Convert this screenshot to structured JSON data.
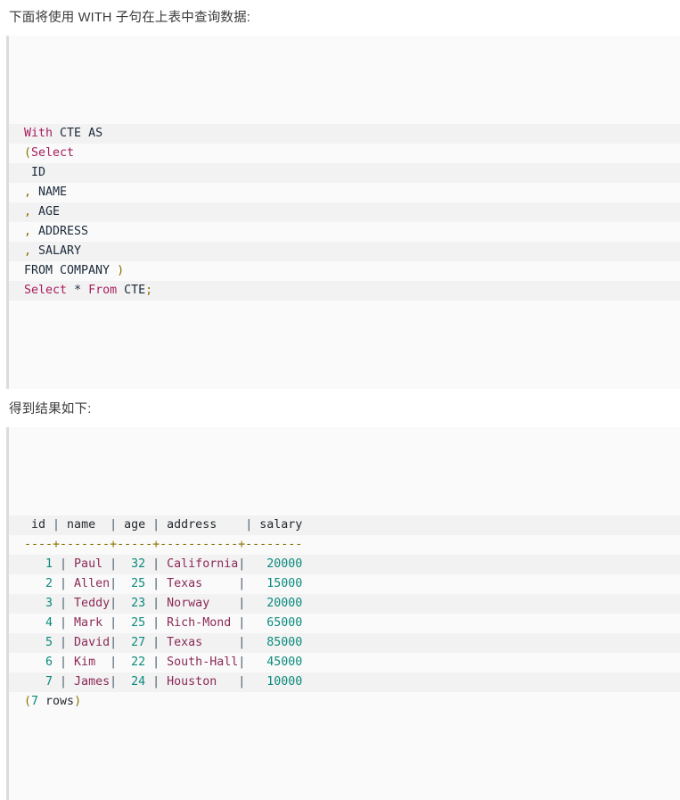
{
  "page": {
    "intro_text": "下面将使用 WITH 子句在上表中查询数据:",
    "result_text": "得到结果如下:"
  },
  "colors": {
    "keyword": "#a71d5d",
    "identifier": "#1c2a3a",
    "punctuation": "#8a7200",
    "number": "#0a8a7d",
    "string": "#8b2a57",
    "pipe": "#4a5a6a",
    "code_bg_odd": "#f2f2f2",
    "code_bg_even": "#fafafa",
    "code_border": "#dcdcdc",
    "text": "#3a3a3a"
  },
  "code_block": {
    "language": "sql",
    "lines": [
      [
        {
          "t": "With",
          "c": "kw"
        },
        {
          "t": " ",
          "c": "plain"
        },
        {
          "t": "CTE AS",
          "c": "id"
        }
      ],
      [
        {
          "t": "(",
          "c": "punc"
        },
        {
          "t": "Select",
          "c": "kw"
        }
      ],
      [
        {
          "t": " ID",
          "c": "id"
        }
      ],
      [
        {
          "t": ",",
          "c": "punc"
        },
        {
          "t": " NAME",
          "c": "id"
        }
      ],
      [
        {
          "t": ",",
          "c": "punc"
        },
        {
          "t": " AGE",
          "c": "id"
        }
      ],
      [
        {
          "t": ",",
          "c": "punc"
        },
        {
          "t": " ADDRESS",
          "c": "id"
        }
      ],
      [
        {
          "t": ",",
          "c": "punc"
        },
        {
          "t": " SALARY",
          "c": "id"
        }
      ],
      [
        {
          "t": "FROM COMPANY ",
          "c": "id"
        },
        {
          "t": ")",
          "c": "punc"
        }
      ],
      [
        {
          "t": "Select",
          "c": "kw"
        },
        {
          "t": " ",
          "c": "plain"
        },
        {
          "t": "*",
          "c": "id"
        },
        {
          "t": " ",
          "c": "plain"
        },
        {
          "t": "From",
          "c": "kw"
        },
        {
          "t": " ",
          "c": "plain"
        },
        {
          "t": "CTE",
          "c": "id"
        },
        {
          "t": ";",
          "c": "punc"
        }
      ]
    ],
    "plain_text": "With CTE AS\n(Select\n ID\n, NAME\n, AGE\n, ADDRESS\n, SALARY\nFROM COMPANY )\nSelect * From CTE;"
  },
  "result_block": {
    "columns": [
      "id",
      "name",
      "age",
      "address",
      "salary"
    ],
    "separator": "----+-------+-----+-----------+--------",
    "rows": [
      {
        "id": "1",
        "name": "Paul",
        "age": "32",
        "address": "California",
        "salary": "20000"
      },
      {
        "id": "2",
        "name": "Allen",
        "age": "25",
        "address": "Texas",
        "salary": "15000"
      },
      {
        "id": "3",
        "name": "Teddy",
        "age": "23",
        "address": "Norway",
        "salary": "20000"
      },
      {
        "id": "4",
        "name": "Mark",
        "age": "25",
        "address": "Rich-Mond",
        "salary": "65000"
      },
      {
        "id": "5",
        "name": "David",
        "age": "27",
        "address": "Texas",
        "salary": "85000"
      },
      {
        "id": "6",
        "name": "Kim",
        "age": "22",
        "address": "South-Hall",
        "salary": "45000"
      },
      {
        "id": "7",
        "name": "James",
        "age": "24",
        "address": "Houston",
        "salary": "10000"
      }
    ],
    "row_count_label": "(7 rows)",
    "row_count": "7",
    "header_line": " id | name  | age | address   | salary",
    "footer_open_paren": "(",
    "footer_text": " rows",
    "footer_close_paren": ")"
  }
}
